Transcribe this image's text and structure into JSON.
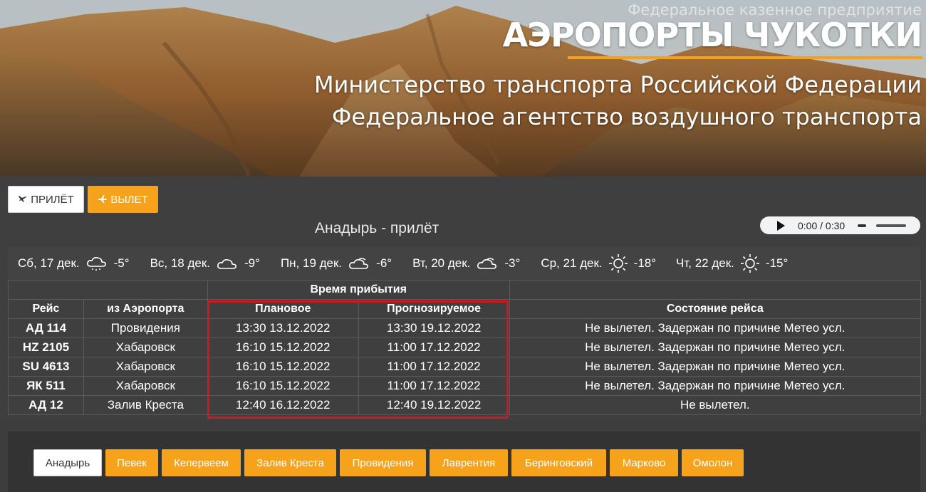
{
  "header": {
    "org_subtitle": "Федеральное казенное предприятие",
    "org_title": "АЭРОПОРТЫ ЧУКОТКИ",
    "ministry": "Министерство транспорта Российской Федерации",
    "agency": "Федеральное агентство воздушного транспорта"
  },
  "mode": {
    "arrival_label": "ПРИЛЁТ",
    "departure_label": "ВЫЛЕТ"
  },
  "board_title": "Анадырь - прилёт",
  "audio": {
    "time": "0:00 / 0:30"
  },
  "weather": [
    {
      "day": "Сб, 17 дек.",
      "icon": "snow-cloud-icon",
      "temp": "-5°"
    },
    {
      "day": "Вс, 18 дек.",
      "icon": "cloud-icon",
      "temp": "-9°"
    },
    {
      "day": "Пн, 19 дек.",
      "icon": "partly-cloudy-icon",
      "temp": "-6°"
    },
    {
      "day": "Вт, 20 дек.",
      "icon": "partly-cloudy-icon",
      "temp": "-3°"
    },
    {
      "day": "Ср, 21 дек.",
      "icon": "sun-icon",
      "temp": "-18°"
    },
    {
      "day": "Чт, 22 дек.",
      "icon": "sun-icon",
      "temp": "-15°"
    }
  ],
  "table": {
    "group_header": "Время прибытия",
    "headers": {
      "flight": "Рейс",
      "from": "из Аэропорта",
      "planned": "Плановое",
      "forecast": "Прогнозируемое",
      "status": "Состояние рейса"
    },
    "rows": [
      {
        "flight": "АД 114",
        "from": "Провидения",
        "planned": "13:30 13.12.2022",
        "forecast": "13:30 19.12.2022",
        "status": "Не вылетел. Задержан по причине Метео усл."
      },
      {
        "flight": "HZ 2105",
        "from": "Хабаровск",
        "planned": "16:10 15.12.2022",
        "forecast": "11:00 17.12.2022",
        "status": "Не вылетел. Задержан по причине Метео усл."
      },
      {
        "flight": "SU 4613",
        "from": "Хабаровск",
        "planned": "16:10 15.12.2022",
        "forecast": "11:00 17.12.2022",
        "status": "Не вылетел. Задержан по причине Метео усл."
      },
      {
        "flight": "ЯК 511",
        "from": "Хабаровск",
        "planned": "16:10 15.12.2022",
        "forecast": "11:00 17.12.2022",
        "status": "Не вылетел. Задержан по причине Метео усл."
      },
      {
        "flight": "АД 12",
        "from": "Залив Креста",
        "planned": "12:40 16.12.2022",
        "forecast": "12:40 19.12.2022",
        "status": "Не вылетел."
      }
    ]
  },
  "airports": [
    {
      "label": "Анадырь",
      "active": true
    },
    {
      "label": "Певек"
    },
    {
      "label": "Кепервеем"
    },
    {
      "label": "Залив Креста"
    },
    {
      "label": "Провидения"
    },
    {
      "label": "Лаврентия"
    },
    {
      "label": "Беринговский"
    },
    {
      "label": "Марково"
    },
    {
      "label": "Омолон"
    }
  ],
  "colors": {
    "accent": "#f7a21b",
    "highlight": "#d8141c"
  }
}
